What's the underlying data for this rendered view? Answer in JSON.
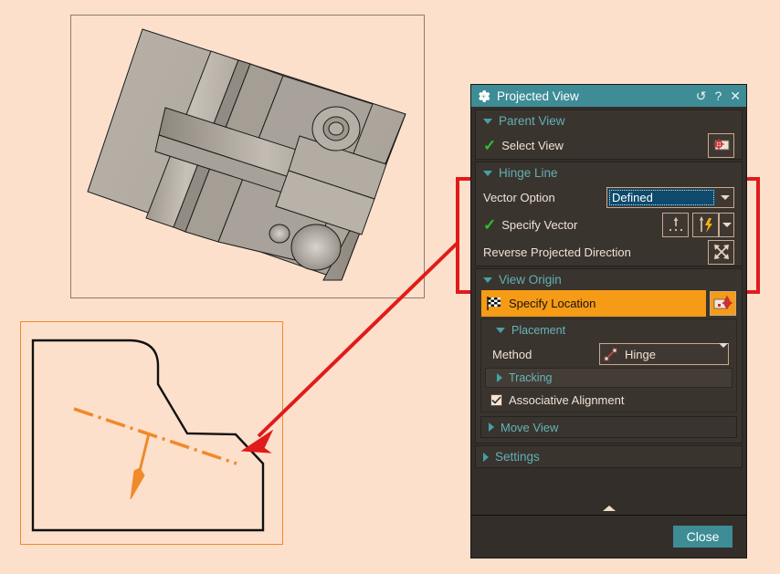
{
  "window": {
    "title": "Projected View",
    "icon": "gear-icon",
    "buttons": [
      {
        "name": "reset-icon",
        "glyph": "↺"
      },
      {
        "name": "help-icon",
        "glyph": "?"
      },
      {
        "name": "close-icon",
        "glyph": "✕"
      }
    ]
  },
  "sections": {
    "parent_view": {
      "title": "Parent View",
      "select_view_label": "Select View",
      "select_view_icon": "select-view-icon"
    },
    "hinge_line": {
      "title": "Hinge Line",
      "vector_option_label": "Vector Option",
      "vector_option_value": "Defined",
      "specify_vector_label": "Specify Vector",
      "reverse_label": "Reverse Projected Direction",
      "reverse_icon": "reverse-direction-icon",
      "vector_dialog_icon": "vector-dialog-icon",
      "vector_infer_icon": "vector-inferred-icon"
    },
    "view_origin": {
      "title": "View Origin",
      "specify_location_label": "Specify Location",
      "specify_location_icon": "checkered-flag-icon",
      "point_tool_icon": "point-move-icon",
      "placement": {
        "title": "Placement",
        "method_label": "Method",
        "method_value": "Hinge",
        "method_icon": "hinge-icon",
        "tracking_label": "Tracking",
        "associative_label": "Associative Alignment",
        "associative_checked": true
      },
      "move_view_label": "Move View"
    },
    "settings": {
      "title": "Settings"
    }
  },
  "footer": {
    "close_label": "Close"
  },
  "colors": {
    "background": "#fde0cb",
    "titlebar": "#3d8c96",
    "panel": "#332e29",
    "section_header_text": "#61b0b5",
    "highlight_orange": "#f59b16",
    "annotation_red": "#e01b1b",
    "hinge_line_orange": "#f08a2a",
    "check_green": "#2fbf2f",
    "selected_field_blue": "#0d4a6b"
  },
  "graphics": {
    "view_3d_name": "3d-model-viewport",
    "view_2d_name": "2d-drawing-viewport",
    "annotation_box_name": "red-highlight-box",
    "annotation_arrow_name": "red-callout-arrow",
    "hinge_line_name": "hinge-line-symbol",
    "direction_arrow_name": "projection-direction-arrow"
  }
}
